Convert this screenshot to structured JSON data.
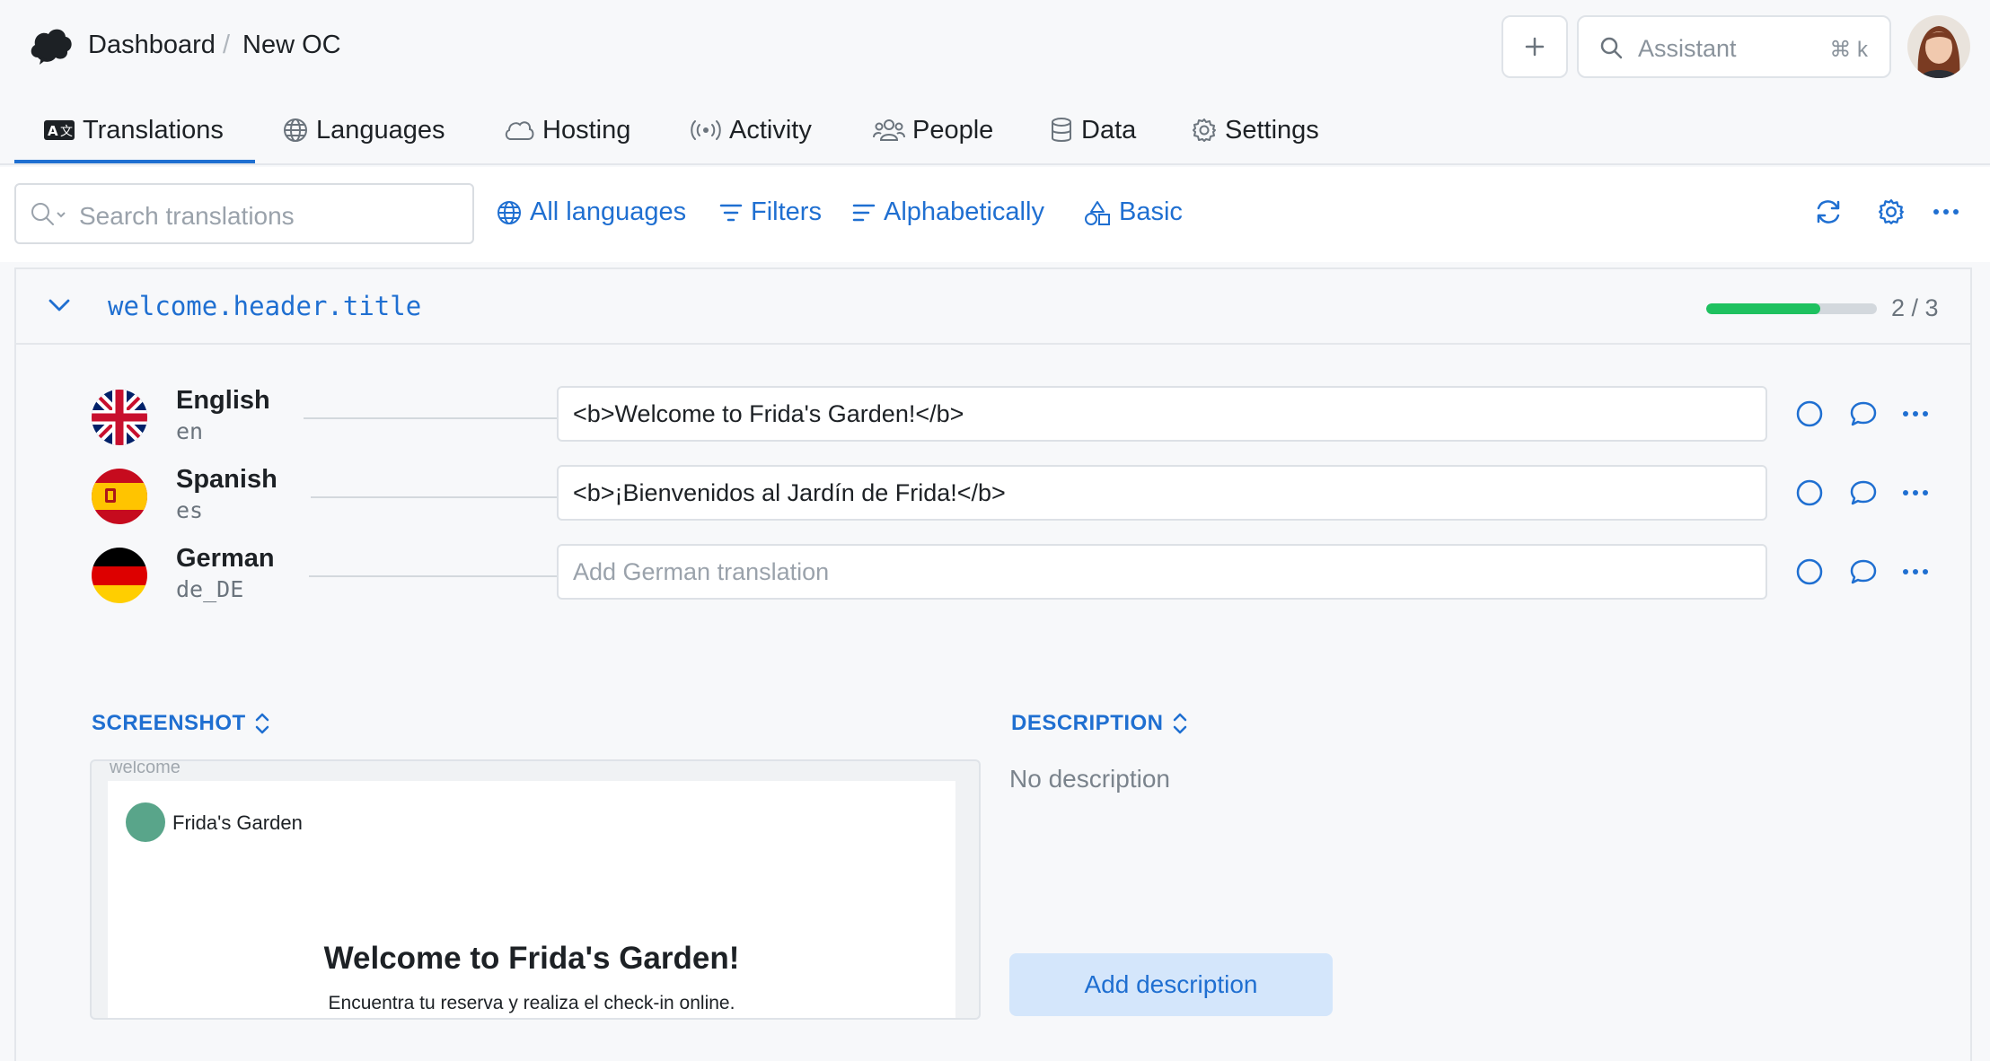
{
  "header": {
    "breadcrumb": [
      "Dashboard",
      "New OC"
    ],
    "separator": "/",
    "assistant_placeholder": "Assistant",
    "assistant_shortcut": "⌘ k"
  },
  "tabs": [
    {
      "label": "Translations",
      "icon": "translate-icon",
      "active": true
    },
    {
      "label": "Languages",
      "icon": "globe-icon"
    },
    {
      "label": "Hosting",
      "icon": "cloud-icon"
    },
    {
      "label": "Activity",
      "icon": "broadcast-icon"
    },
    {
      "label": "People",
      "icon": "people-icon"
    },
    {
      "label": "Data",
      "icon": "database-icon"
    },
    {
      "label": "Settings",
      "icon": "gear-icon"
    }
  ],
  "toolbar": {
    "search_placeholder": "Search translations",
    "language_filter": "All languages",
    "filters": "Filters",
    "sort": "Alphabetically",
    "view_mode": "Basic"
  },
  "key_item": {
    "key": "welcome.header.title",
    "progress_fraction": 0.667,
    "progress_text": "2 / 3",
    "translations": [
      {
        "language": "English",
        "code": "en",
        "value": "<b>Welcome to Frida's Garden!</b>",
        "placeholder": ""
      },
      {
        "language": "Spanish",
        "code": "es",
        "value": "<b>¡Bienvenidos al Jardín de Frida!</b>",
        "placeholder": ""
      },
      {
        "language": "German",
        "code": "de_DE",
        "value": "",
        "placeholder": "Add German translation"
      }
    ]
  },
  "screenshot_section": {
    "label": "SCREENSHOT",
    "preview_top_text": "welcome",
    "preview_brand": "Frida's Garden",
    "preview_title": "Welcome to Frida's Garden!",
    "preview_subtitle": "Encuentra tu reserva y realiza el check-in online."
  },
  "description_section": {
    "label": "DESCRIPTION",
    "empty_text": "No description",
    "add_button": "Add description"
  },
  "colors": {
    "accent": "#1f6fd1",
    "progress": "#1ec15f"
  }
}
